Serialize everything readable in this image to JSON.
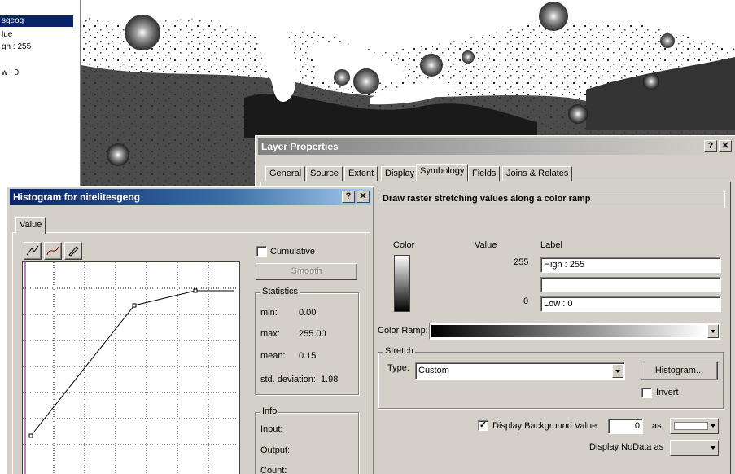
{
  "toc": {
    "layer_name": "sgeog",
    "value_label": "lue",
    "high_label": "gh : 255",
    "low_label": "w : 0"
  },
  "layer_properties": {
    "title": "Layer Properties",
    "tabs": [
      "General",
      "Source",
      "Extent",
      "Display",
      "Symbology",
      "Fields",
      "Joins & Relates"
    ],
    "active_tab": "Symbology",
    "heading": "Draw raster stretching values along a color ramp",
    "col_color": "Color",
    "col_value": "Value",
    "col_label": "Label",
    "high_value": "255",
    "high_label": "High : 255",
    "mid_label": "",
    "low_value": "0",
    "low_label": "Low : 0",
    "color_ramp_label": "Color Ramp:",
    "stretch_title": "Stretch",
    "type_label": "Type:",
    "type_value": "Custom",
    "histogram_button": "Histogram...",
    "invert_label": "Invert",
    "display_bg_label": "Display Background Value:",
    "bg_value": "0",
    "as_label": "as",
    "nodata_label": "Display NoData as"
  },
  "histogram": {
    "title": "Histogram for nitelitesgeog",
    "tab": "Value",
    "cumulative_label": "Cumulative",
    "smooth_button": "Smooth",
    "statistics_title": "Statistics",
    "stats": [
      {
        "label": "min:",
        "value": "0.00"
      },
      {
        "label": "max:",
        "value": "255.00"
      },
      {
        "label": "mean:",
        "value": "0.15"
      },
      {
        "label": "std. deviation:",
        "value": "1.98"
      }
    ],
    "info_title": "Info",
    "info": [
      "Input:",
      "Output:",
      "Count:"
    ]
  },
  "colors": {
    "title_active": "#0a246a",
    "title_gradient_end": "#a6caf0",
    "dialog_face": "#d4d0c8"
  }
}
